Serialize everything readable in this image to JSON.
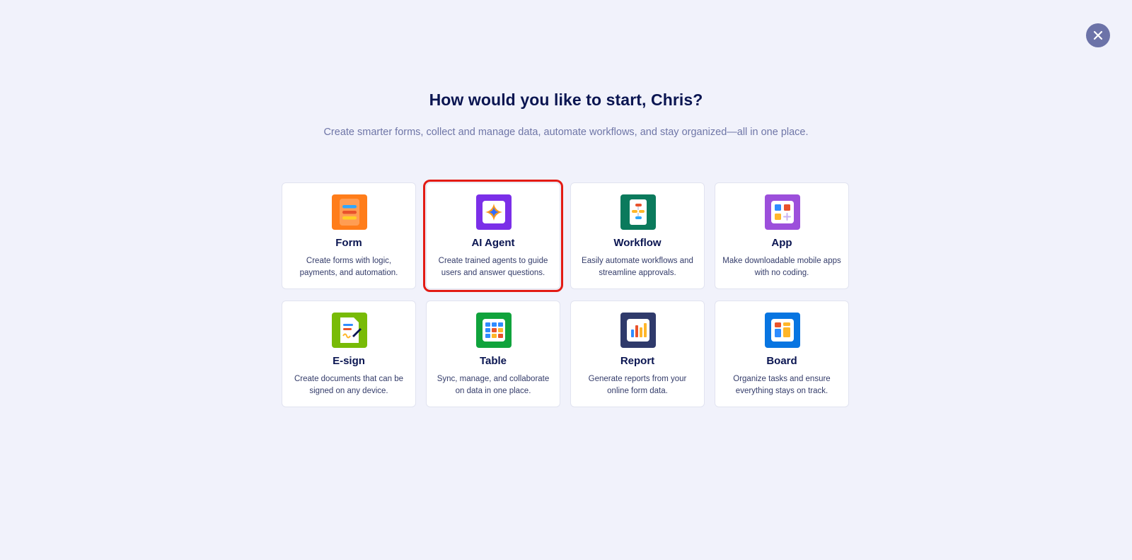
{
  "header": {
    "title": "How would you like to start, Chris?",
    "subtitle": "Create smarter forms, collect and manage data, automate workflows, and stay organized—all in one place."
  },
  "close_icon": "close-icon",
  "cards": [
    {
      "name": "Form",
      "description": "Create forms with logic, payments, and automation.",
      "icon": "form-icon",
      "color": "#ff7d1a",
      "selected": false
    },
    {
      "name": "AI Agent",
      "description": "Create trained agents to guide users and answer questions.",
      "icon": "ai-agent-icon",
      "color": "#7b2fe8",
      "selected": true
    },
    {
      "name": "Workflow",
      "description": "Easily automate workflows and streamline approvals.",
      "icon": "workflow-icon",
      "color": "#0b7a5c",
      "selected": false
    },
    {
      "name": "App",
      "description": "Make downloadable mobile apps with no coding.",
      "icon": "app-icon",
      "color": "#9c4fdb",
      "selected": false
    },
    {
      "name": "E-sign",
      "description": "Create documents that can be signed on any device.",
      "icon": "esign-icon",
      "color": "#78bb07",
      "selected": false
    },
    {
      "name": "Table",
      "description": "Sync, manage, and collaborate on data in one place.",
      "icon": "table-icon",
      "color": "#10a33c",
      "selected": false
    },
    {
      "name": "Report",
      "description": "Generate reports from your online form data.",
      "icon": "report-icon",
      "color": "#2f3a6b",
      "selected": false
    },
    {
      "name": "Board",
      "description": "Organize tasks and ensure everything stays on track.",
      "icon": "board-icon",
      "color": "#0875e1",
      "selected": false
    }
  ],
  "colors": {
    "background": "#f1f2fb",
    "selected_outline": "#e31b14",
    "close_button": "#6c73a8"
  }
}
